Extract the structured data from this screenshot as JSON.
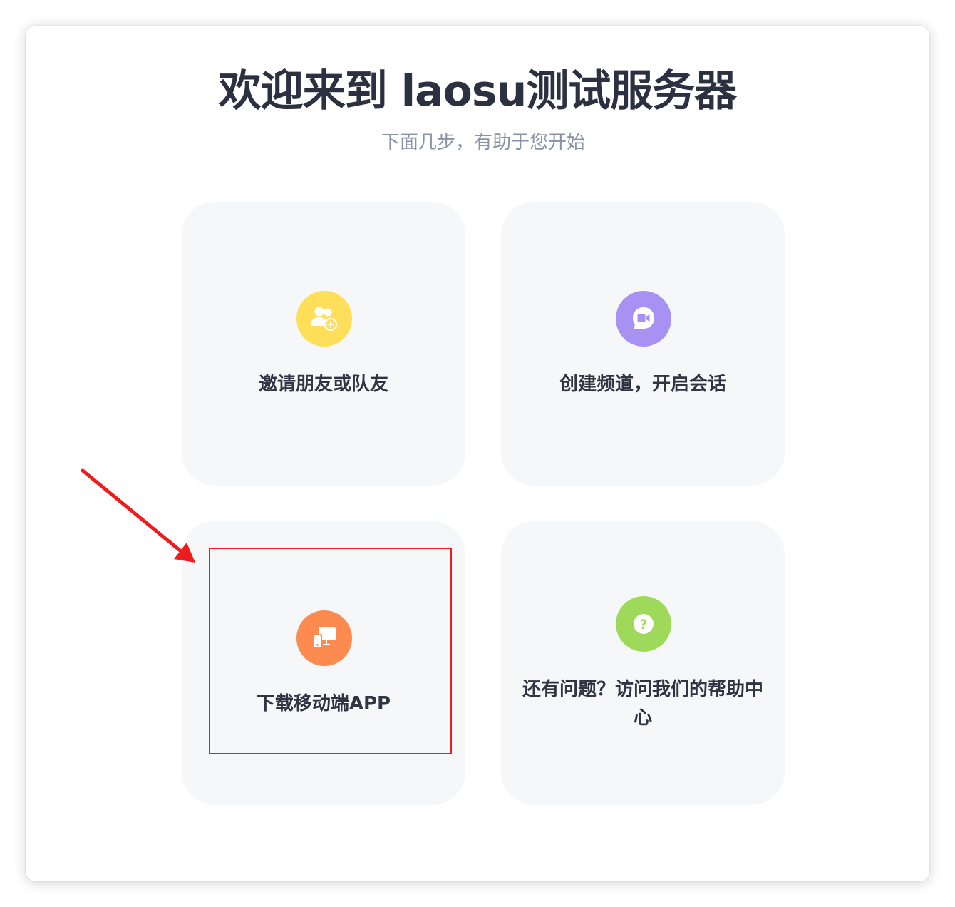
{
  "header": {
    "title": "欢迎来到 laosu测试服务器",
    "subtitle": "下面几步，有助于您开始"
  },
  "cards": [
    {
      "label": "邀请朋友或队友",
      "icon": "add-users-icon",
      "color": "#ffde5a"
    },
    {
      "label": "创建频道，开启会话",
      "icon": "video-chat-icon",
      "color": "#a792f3"
    },
    {
      "label": "下载移动端APP",
      "icon": "devices-icon",
      "color": "#fd8a4f"
    },
    {
      "label": "还有问题？访问我们的帮助中心",
      "icon": "help-question-icon",
      "color": "#9fd95a"
    }
  ],
  "annotation": {
    "arrow_color": "#ee1d1d",
    "highlight_color": "#ee1d1d"
  }
}
